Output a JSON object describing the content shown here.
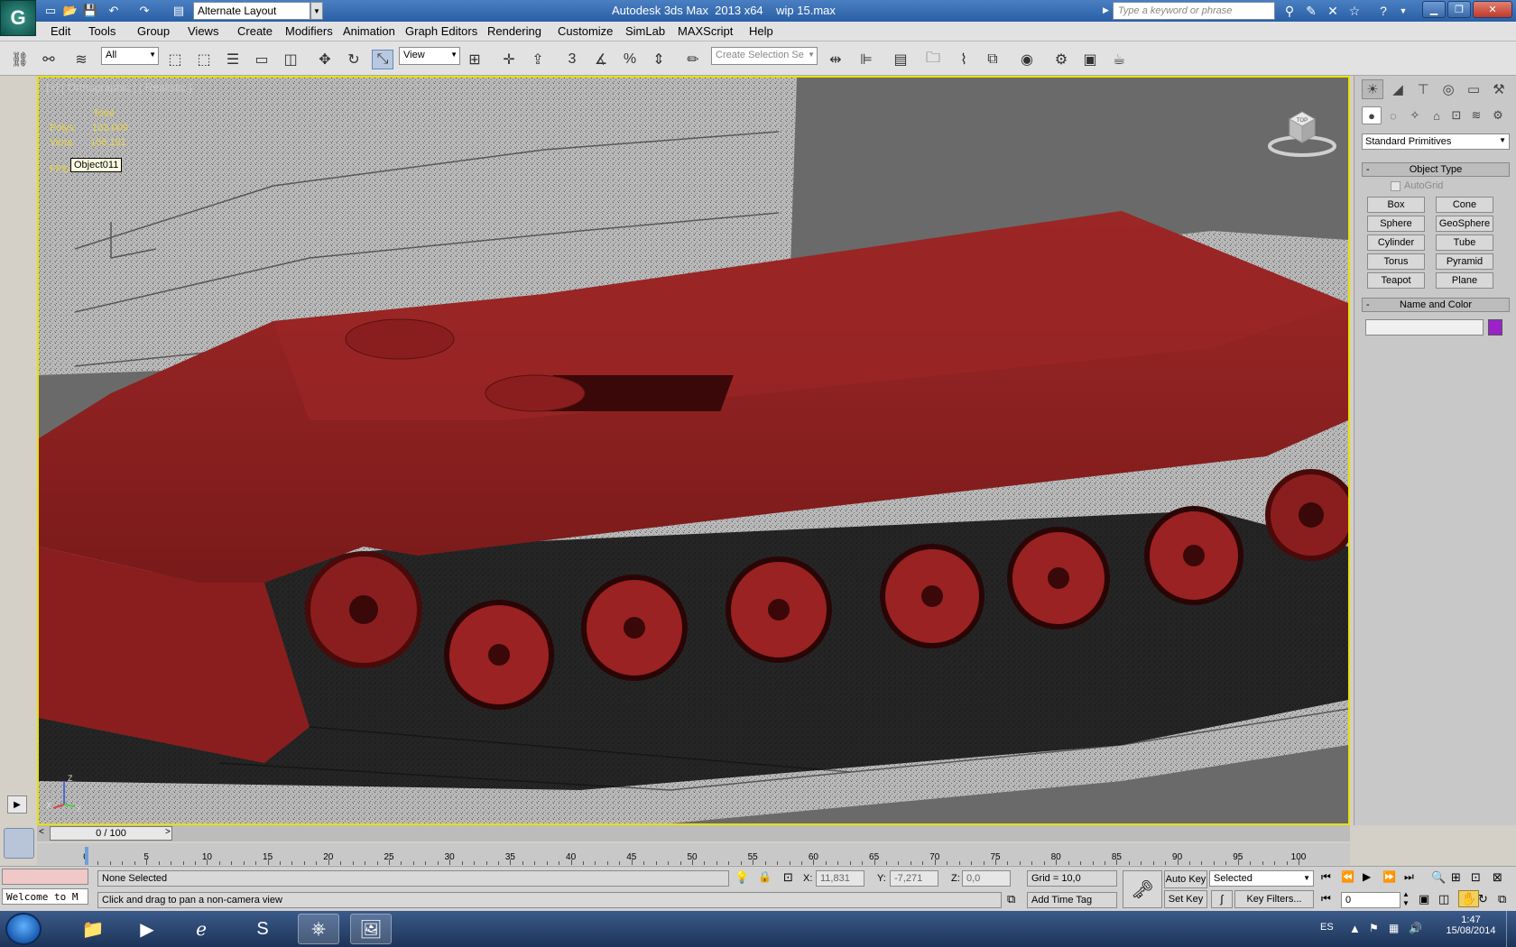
{
  "titlebar": {
    "logo_letter": "G",
    "workspace": "Alternate Layout",
    "app_name": "Autodesk 3ds Max  2013 x64",
    "file_name": "wip 15.max",
    "search_placeholder": "Type a keyword or phrase"
  },
  "menu": [
    "Edit",
    "Tools",
    "Group",
    "Views",
    "Create",
    "Modifiers",
    "Animation",
    "Graph Editors",
    "Rendering",
    "Customize",
    "SimLab",
    "MAXScript",
    "Help"
  ],
  "toolbar": {
    "filter": "All",
    "ref_coord": "View",
    "snap_3": "3",
    "selection_set_placeholder": "Create Selection Se"
  },
  "viewport": {
    "label": "[+] [ Orthographic ] [ Realistic ]",
    "stats": {
      "total_label": "Total",
      "polys_label": "Polys:",
      "polys_value": "103,009",
      "verts_label": "Verts:",
      "verts_value": "156,101",
      "fps_label": "FPS:",
      "fps_value": "41,067"
    },
    "tooltip": "Object011",
    "axis_z": "Z",
    "axis_x": "X",
    "axis_y": "Y",
    "viewcube_text": "TOP"
  },
  "panel": {
    "category": "Standard Primitives",
    "object_type_title": "Object Type",
    "autogrid": "AutoGrid",
    "buttons": [
      "Box",
      "Cone",
      "Sphere",
      "GeoSphere",
      "Cylinder",
      "Tube",
      "Torus",
      "Pyramid",
      "Teapot",
      "Plane"
    ],
    "name_color_title": "Name and Color",
    "color": "#9b22c8"
  },
  "timeline": {
    "frame": "0 / 100",
    "ticks": [
      "0",
      "5",
      "10",
      "15",
      "20",
      "25",
      "30",
      "35",
      "40",
      "45",
      "50",
      "55",
      "60",
      "65",
      "70",
      "75",
      "80",
      "85",
      "90",
      "95",
      "100"
    ]
  },
  "status": {
    "maxscript": "Welcome to M",
    "selection": "None Selected",
    "prompt": "Click and drag to pan a non-camera view",
    "x_label": "X:",
    "x_value": "11,831",
    "y_label": "Y:",
    "y_value": "-7,271",
    "z_label": "Z:",
    "z_value": "0,0",
    "grid": "Grid = 10,0",
    "add_time_tag": "Add Time Tag",
    "auto_key": "Auto Key",
    "set_key": "Set Key",
    "key_mode": "Selected",
    "key_filters": "Key Filters...",
    "current_frame": "0"
  },
  "taskbar": {
    "lang": "ES",
    "time": "1:47",
    "date": "15/08/2014"
  }
}
